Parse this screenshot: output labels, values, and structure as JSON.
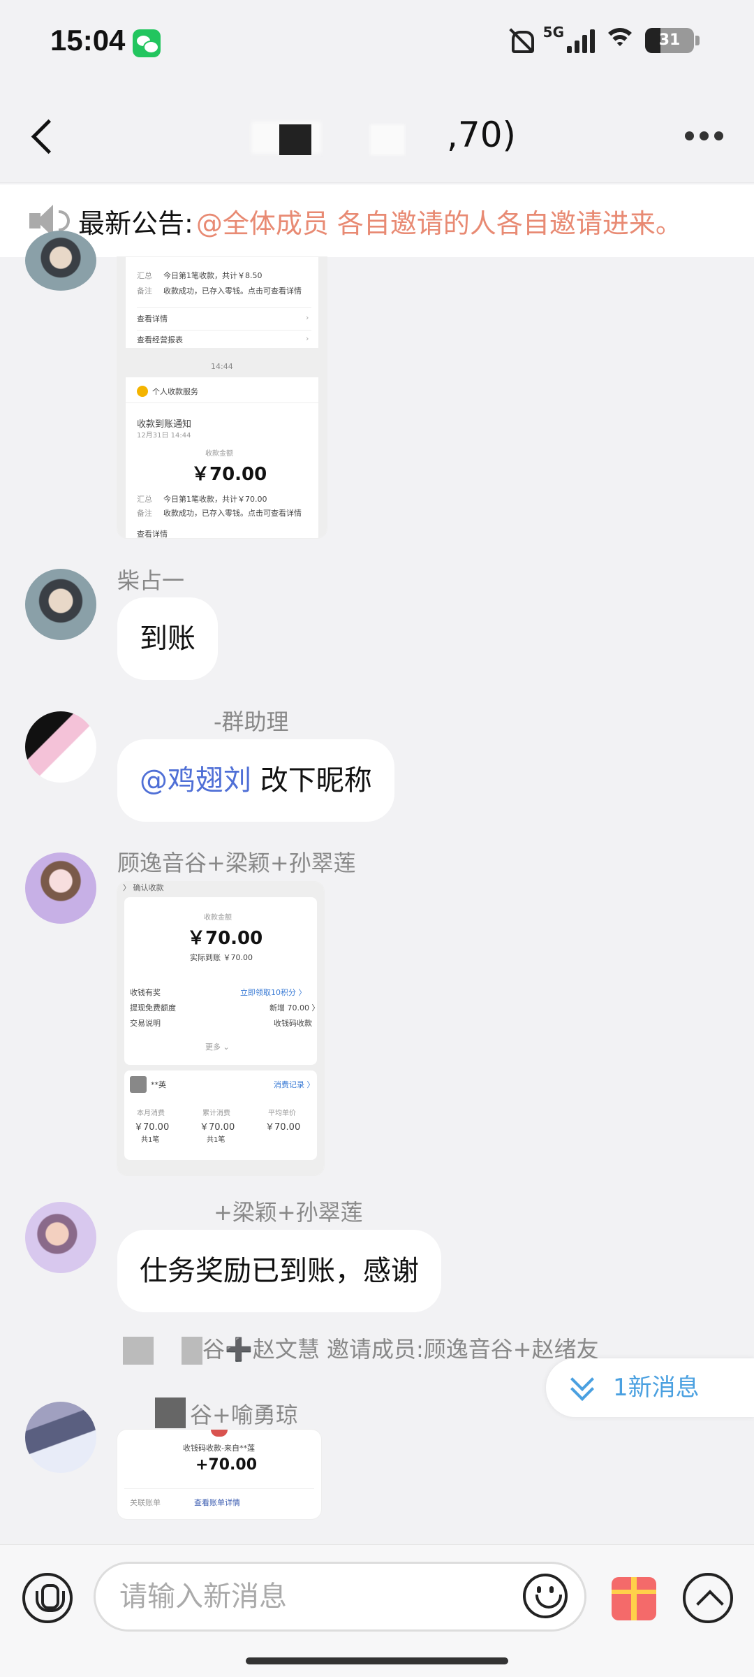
{
  "status": {
    "time": "15:04",
    "network": "5G",
    "battery": "31",
    "battery_level": 0.31
  },
  "header": {
    "title": ",70)"
  },
  "notice": {
    "label": "最新公告:",
    "text": "@全体成员 各自邀请的人各自邀请进来。"
  },
  "shot1": {
    "rows": [
      {
        "k": "汇总",
        "v": "今日第1笔收款，共计￥8.50"
      },
      {
        "k": "备注",
        "v": "收款成功，已存入零钱。点击可查看详情"
      }
    ],
    "links": [
      "查看详情",
      "查看经营报表"
    ],
    "time": "14:44",
    "service": "个人收款服务",
    "notify_title": "收款到账通知",
    "notify_date": "12月31日 14:44",
    "amount_label": "收款金额",
    "amount": "￥70.00",
    "rows2": [
      {
        "k": "汇总",
        "v": "今日第1笔收款，共计￥70.00"
      },
      {
        "k": "备注",
        "v": "收款成功，已存入零钱。点击可查看详情"
      }
    ],
    "footer": "查看详情"
  },
  "msg1": {
    "sender": "柴占一",
    "text": "到账"
  },
  "msg2": {
    "sender": "-群助理",
    "at": "@鸡翅刘",
    "text": " 改下昵称"
  },
  "msg3": {
    "sender": "顾逸音谷+梁颖+孙翠莲"
  },
  "shot2": {
    "top": "〉 确认收款",
    "amount_label": "收款金额",
    "amount": "￥70.00",
    "actual": "实际到账 ￥70.00",
    "rows": [
      {
        "k": "收钱有奖",
        "v": "立即领取10积分 〉"
      },
      {
        "k": "提现免费额度",
        "v": "新增 70.00 〉"
      },
      {
        "k": "交易说明",
        "v": "收钱码收款"
      }
    ],
    "more": "更多 ⌄",
    "payer": "**英",
    "record": "消费记录 〉",
    "stats": [
      {
        "k": "本月消费",
        "v": "￥70.00",
        "n": "共1笔"
      },
      {
        "k": "累计消费",
        "v": "￥70.00",
        "n": "共1笔"
      },
      {
        "k": "平均单价",
        "v": "￥70.00",
        "n": ""
      }
    ]
  },
  "msg4": {
    "sender": "+梁颖+孙翠莲",
    "text": "仕务奖励已到账，感谢"
  },
  "system": {
    "text": "谷➕赵文慧 邀请成员:顾逸音谷+赵绪友"
  },
  "new_msg": {
    "label": "1新消息"
  },
  "msg5": {
    "sender": "谷+喻勇琼"
  },
  "shot3": {
    "title": "收钱码收款-来自**莲",
    "amount": "+70.00",
    "k": "关联账单",
    "v": "查看账单详情"
  },
  "input": {
    "placeholder": "请输入新消息"
  }
}
